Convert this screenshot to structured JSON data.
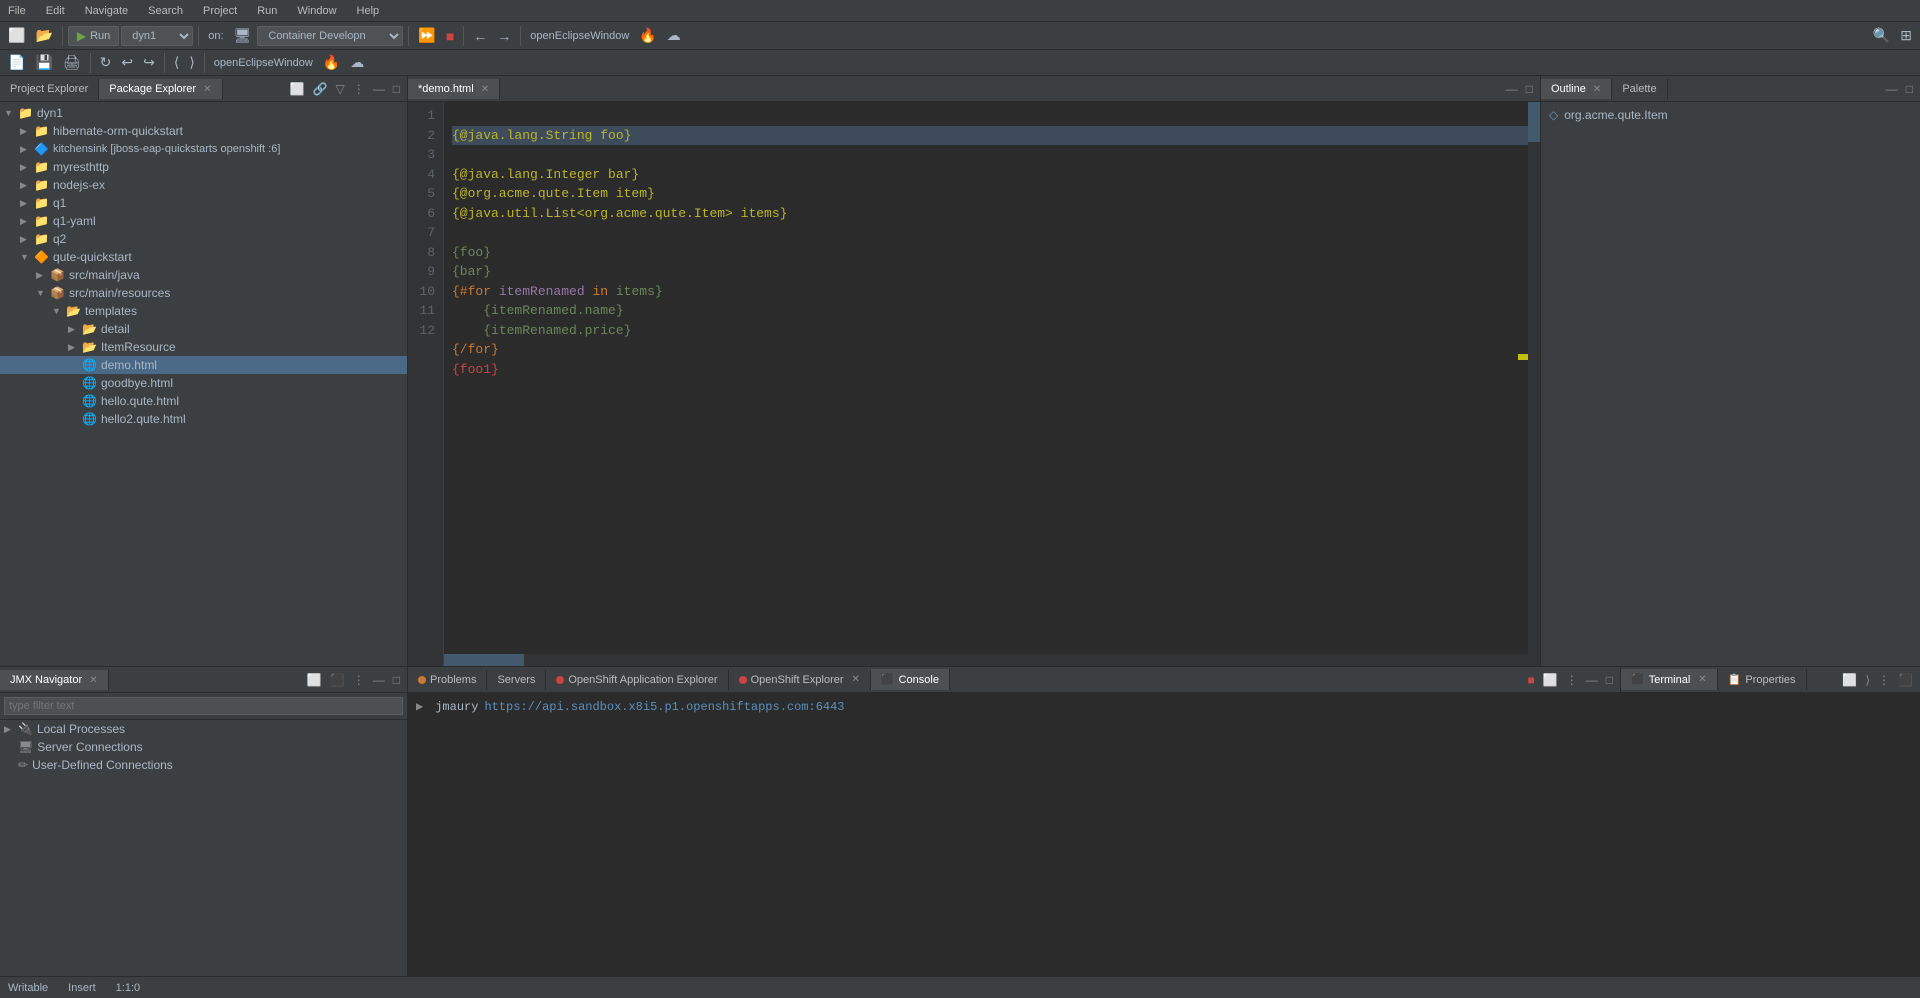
{
  "menubar": {
    "items": [
      "File",
      "Edit",
      "Navigate",
      "Search",
      "Project",
      "Run",
      "Window",
      "Help"
    ]
  },
  "toolbar": {
    "run_label": "Run",
    "run_config": "dyn1",
    "on_label": "on:",
    "container_config": "Container Developn",
    "openeclipse_window": "openEclipseWindow"
  },
  "explorer": {
    "tab1": "Project Explorer",
    "tab2": "Package Explorer",
    "tree": [
      {
        "id": "dyn1",
        "label": "dyn1",
        "level": 0,
        "expanded": true,
        "type": "project"
      },
      {
        "id": "hibernate",
        "label": "hibernate-orm-quickstart",
        "level": 1,
        "expanded": false,
        "type": "project"
      },
      {
        "id": "kitchensink",
        "label": "kitchensink [jboss-eap-quickstarts openshift :6]",
        "level": 1,
        "expanded": false,
        "type": "project-special"
      },
      {
        "id": "myresthttp",
        "label": "myresthttp",
        "level": 1,
        "expanded": false,
        "type": "project"
      },
      {
        "id": "nodejs-ex",
        "label": "nodejs-ex",
        "level": 1,
        "expanded": false,
        "type": "project"
      },
      {
        "id": "q1",
        "label": "q1",
        "level": 1,
        "expanded": false,
        "type": "project"
      },
      {
        "id": "q1-yaml",
        "label": "q1-yaml",
        "level": 1,
        "expanded": false,
        "type": "project"
      },
      {
        "id": "q2",
        "label": "q2",
        "level": 1,
        "expanded": false,
        "type": "project"
      },
      {
        "id": "qute-quickstart",
        "label": "qute-quickstart",
        "level": 1,
        "expanded": true,
        "type": "project"
      },
      {
        "id": "src-main-java",
        "label": "src/main/java",
        "level": 2,
        "expanded": false,
        "type": "src"
      },
      {
        "id": "src-main-resources",
        "label": "src/main/resources",
        "level": 2,
        "expanded": true,
        "type": "src"
      },
      {
        "id": "templates",
        "label": "templates",
        "level": 3,
        "expanded": true,
        "type": "folder"
      },
      {
        "id": "detail",
        "label": "detail",
        "level": 4,
        "expanded": false,
        "type": "folder"
      },
      {
        "id": "ItemResource",
        "label": "ItemResource",
        "level": 4,
        "expanded": false,
        "type": "folder"
      },
      {
        "id": "demo.html",
        "label": "demo.html",
        "level": 4,
        "expanded": false,
        "type": "html"
      },
      {
        "id": "goodbye.html",
        "label": "goodbye.html",
        "level": 4,
        "expanded": false,
        "type": "html"
      },
      {
        "id": "hello.qute.html",
        "label": "hello.qute.html",
        "level": 4,
        "expanded": false,
        "type": "html"
      },
      {
        "id": "hello2.qute.html",
        "label": "hello2.qute.html",
        "level": 4,
        "expanded": false,
        "type": "html"
      }
    ]
  },
  "editor": {
    "tab_label": "*demo.html",
    "lines": [
      {
        "num": 1,
        "code": "{@java.lang.String foo}",
        "type": "annotation"
      },
      {
        "num": 2,
        "code": "{@java.lang.Integer bar}",
        "type": "annotation"
      },
      {
        "num": 3,
        "code": "{@org.acme.qute.Item item}",
        "type": "annotation"
      },
      {
        "num": 4,
        "code": "{@java.util.List<org.acme.qute.Item> items}",
        "type": "annotation"
      },
      {
        "num": 5,
        "code": "",
        "type": "normal"
      },
      {
        "num": 6,
        "code": "{foo}",
        "type": "template"
      },
      {
        "num": 7,
        "code": "{bar}",
        "type": "template"
      },
      {
        "num": 8,
        "code": "{#for itemRenamed in items}",
        "type": "template"
      },
      {
        "num": 9,
        "code": "    {itemRenamed.name}",
        "type": "template"
      },
      {
        "num": 10,
        "code": "    {itemRenamed.price}",
        "type": "template"
      },
      {
        "num": 11,
        "code": "{/for}",
        "type": "template"
      },
      {
        "num": 12,
        "code": "{foo1}",
        "type": "template"
      }
    ]
  },
  "outline": {
    "tab_label": "Outline",
    "tab2_label": "Palette",
    "items": [
      {
        "label": "org.acme.qute.Item",
        "type": "class"
      }
    ]
  },
  "jmx": {
    "tab_label": "JMX Navigator",
    "filter_placeholder": "type filter text",
    "items": [
      {
        "label": "Local Processes",
        "level": 0,
        "type": "folder",
        "expanded": false
      },
      {
        "label": "Server Connections",
        "level": 0,
        "type": "server"
      },
      {
        "label": "User-Defined Connections",
        "level": 0,
        "type": "connection"
      }
    ]
  },
  "bottom_tabs": {
    "tabs": [
      "Problems",
      "Servers",
      "OpenShift Application Explorer",
      "OpenShift Explorer",
      "Console"
    ],
    "active": "Console",
    "right_tabs": [
      "Terminal",
      "Properties"
    ]
  },
  "console": {
    "items": [
      {
        "name": "jmaury",
        "url": "https://api.sandbox.x8i5.p1.openshiftapps.com:6443"
      }
    ]
  },
  "statusbar": {
    "writable": "Writable",
    "insert": "Insert",
    "position": "1:1:0"
  }
}
